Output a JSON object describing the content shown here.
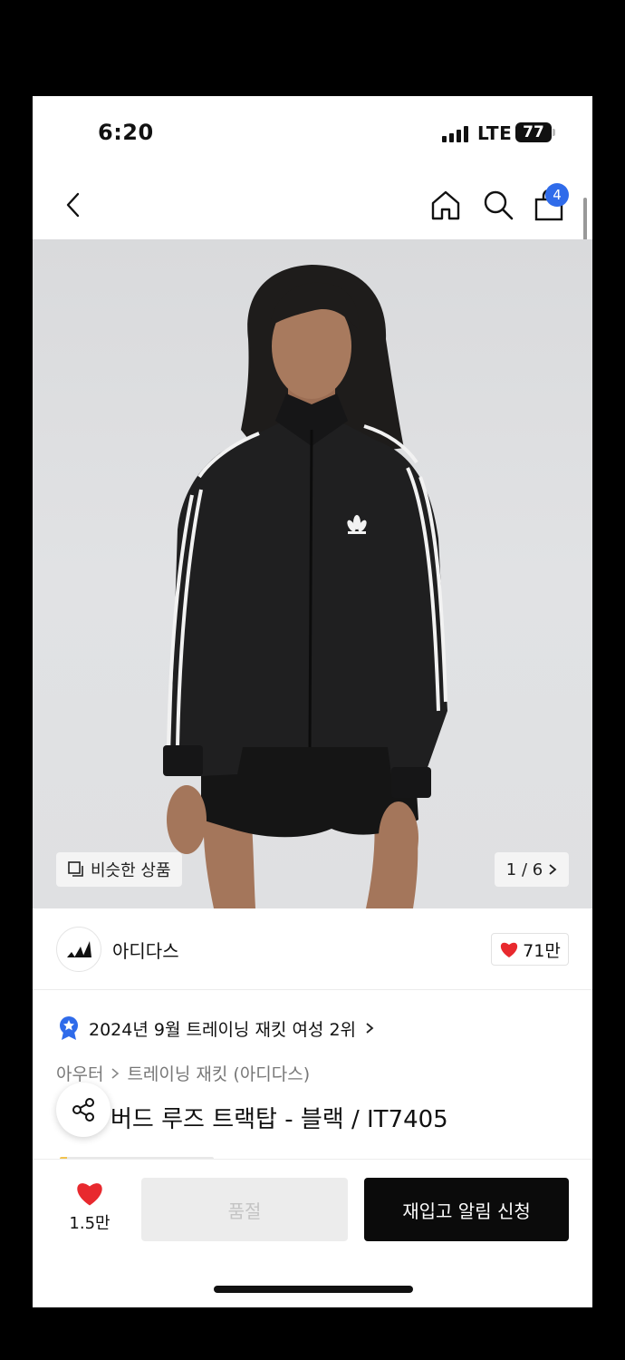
{
  "status_bar": {
    "time": "6:20",
    "network": "LTE",
    "battery": "77"
  },
  "nav": {
    "cart_count": "4",
    "icons": [
      "back-arrow-icon",
      "home-icon",
      "search-icon",
      "shopping-bag-icon"
    ]
  },
  "product_image": {
    "similar_label": "비슷한 상품",
    "pager": "1 / 6"
  },
  "brand": {
    "name": "아디다스",
    "likes": "71만"
  },
  "ranking": {
    "text": "2024년 9월 트레이닝 재킷 여성 2위"
  },
  "breadcrumb": {
    "category": "아우터",
    "subcategory": "트레이닝 재킷 (아디다스)"
  },
  "product": {
    "title": "파이어버드 루즈 트랙탑 - 블랙 / IT7405",
    "title_visible": "버드 루즈 트랙탑 - 블랙 / IT7405"
  },
  "actions": {
    "wish_count": "1.5만",
    "soldout_label": "품절",
    "restock_label": "재입고 알림 신청"
  },
  "colors": {
    "accent_blue": "#2f6bea",
    "heart_red": "#e8292e",
    "primary_button": "#0b0b0b"
  }
}
